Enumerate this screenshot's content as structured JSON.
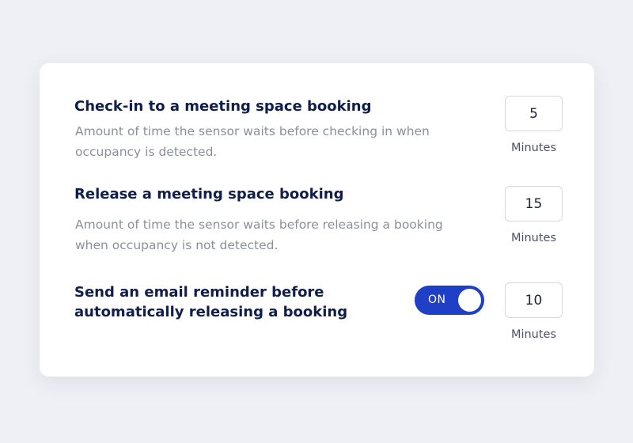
{
  "settings": [
    {
      "title": "Check-in to a meeting space booking",
      "description": "Amount of time the sensor waits before checking in when occupancy is detected.",
      "value": "5",
      "unit": "Minutes"
    },
    {
      "title": "Release a meeting space booking",
      "description": "Amount of time the sensor waits before releasing a booking when occupancy is not detected.",
      "value": "15",
      "unit": "Minutes"
    },
    {
      "title": "Send an email reminder before automatically releasing a booking",
      "toggle": {
        "label": "ON",
        "state": true
      },
      "value": "10",
      "unit": "Minutes"
    }
  ],
  "colors": {
    "background": "#eef0f5",
    "card": "#ffffff",
    "title": "#0f1e4a",
    "description": "#8a8f9c",
    "toggle_on": "#1e3fc6"
  }
}
